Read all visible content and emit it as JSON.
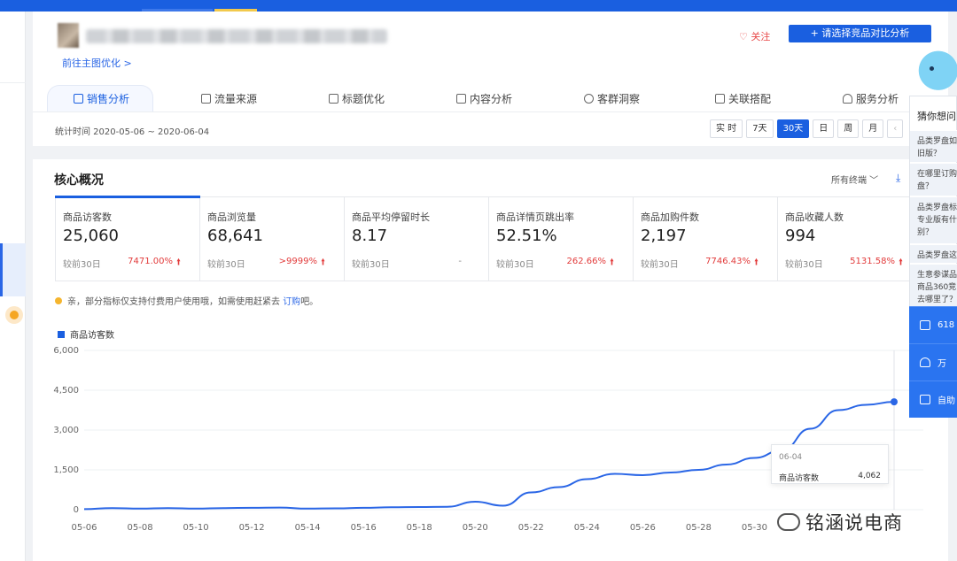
{
  "header": {
    "follow_label": "♡ 关注",
    "compare_label": "+ 请选择竞品对比分析",
    "optimize_link": "前往主图优化 >"
  },
  "tabs": [
    {
      "label": "销售分析",
      "icon": "shop-icon",
      "active": true
    },
    {
      "label": "流量来源",
      "icon": "trend-icon"
    },
    {
      "label": "标题优化",
      "icon": "trend-icon"
    },
    {
      "label": "内容分析",
      "icon": "doc-icon"
    },
    {
      "label": "客群洞察",
      "icon": "users-icon"
    },
    {
      "label": "关联搭配",
      "icon": "link-icon"
    },
    {
      "label": "服务分析",
      "icon": "headset-icon"
    }
  ],
  "date_range": "统计时间 2020-05-06 ~ 2020-06-04",
  "range_buttons": [
    "实 时",
    "7天",
    "30天",
    "日",
    "周",
    "月",
    "‹"
  ],
  "range_active": "30天",
  "core": {
    "title": "核心概况",
    "terminal": "所有终端 ﹀",
    "download_icon": "download-icon",
    "metrics": [
      {
        "label": "商品访客数",
        "value": "25,060",
        "compare": "较前30日",
        "change": "7471.00%",
        "arrow": "🠙"
      },
      {
        "label": "商品浏览量",
        "value": "68,641",
        "compare": "较前30日",
        "change": ">9999%",
        "arrow": "🠙"
      },
      {
        "label": "商品平均停留时长",
        "value": "8.17",
        "compare": "较前30日",
        "change": "-",
        "arrow": ""
      },
      {
        "label": "商品详情页跳出率",
        "value": "52.51%",
        "compare": "较前30日",
        "change": "262.66%",
        "arrow": "🠙"
      },
      {
        "label": "商品加购件数",
        "value": "2,197",
        "compare": "较前30日",
        "change": "7746.43%",
        "arrow": "🠙"
      },
      {
        "label": "商品收藏人数",
        "value": "994",
        "compare": "较前30日",
        "change": "5131.58%",
        "arrow": "🠙"
      }
    ],
    "notice_text": "亲，部分指标仅支持付费用户使用哦，如需使用赶紧去",
    "notice_link": "订购",
    "notice_tail": "吧。"
  },
  "chart_data": {
    "type": "line",
    "x": [
      "05-06",
      "05-07",
      "05-08",
      "05-09",
      "05-10",
      "05-11",
      "05-12",
      "05-13",
      "05-14",
      "05-15",
      "05-16",
      "05-17",
      "05-18",
      "05-19",
      "05-20",
      "05-21",
      "05-22",
      "05-23",
      "05-24",
      "05-25",
      "05-26",
      "05-27",
      "05-28",
      "05-29",
      "05-30",
      "05-31",
      "06-01",
      "06-02",
      "06-03",
      "06-04"
    ],
    "x_tick_labels": [
      "05-06",
      "05-08",
      "05-10",
      "05-12",
      "05-14",
      "05-16",
      "05-18",
      "05-20",
      "05-22",
      "05-24",
      "05-26",
      "05-28",
      "05-30"
    ],
    "series": [
      {
        "name": "商品访客数",
        "values": [
          20,
          60,
          40,
          60,
          40,
          60,
          70,
          80,
          40,
          50,
          70,
          90,
          100,
          110,
          300,
          150,
          650,
          850,
          1150,
          1350,
          1300,
          1400,
          1500,
          1700,
          1950,
          2250,
          3050,
          3750,
          3950,
          4062
        ]
      }
    ],
    "ylim": [
      0,
      6000
    ],
    "y_ticks": [
      0,
      1500,
      3000,
      4500,
      6000
    ],
    "y_tick_labels": [
      "0",
      "1,500",
      "3,000",
      "4,500",
      "6,000"
    ],
    "grid": true,
    "line_color": "#2a66e6",
    "tooltip": {
      "date": "06-04",
      "name": "商品访客数",
      "value": "4,062"
    }
  },
  "side": {
    "help_title": "猜你想问",
    "help_items": [
      "品类罗盘如\n旧版？",
      "在哪里订购\n盘？",
      "品类罗盘标\n专业版有什\n别？",
      "品类罗盘这",
      "生意参谋品\n商品360竞\n去哪里了？"
    ],
    "blue_items": [
      {
        "label": "618",
        "icon": "promo-icon"
      },
      {
        "label": "万",
        "icon": "bell-icon"
      },
      {
        "label": "自助",
        "icon": "chat-icon"
      }
    ]
  },
  "watermark": "铭涵说电商"
}
